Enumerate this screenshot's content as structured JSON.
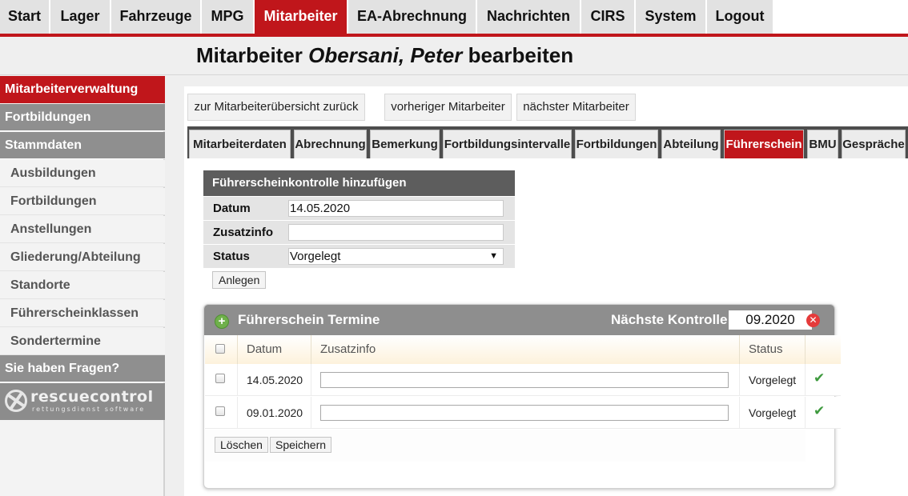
{
  "nav": {
    "items": [
      {
        "label": "Start"
      },
      {
        "label": "Lager"
      },
      {
        "label": "Fahrzeuge"
      },
      {
        "label": "MPG"
      },
      {
        "label": "Mitarbeiter",
        "active": true
      },
      {
        "label": "EA-Abrechnung"
      },
      {
        "label": "Nachrichten"
      },
      {
        "label": "CIRS"
      },
      {
        "label": "System"
      },
      {
        "label": "Logout"
      }
    ],
    "accent_color": "#c0161b"
  },
  "title": {
    "prefix": "Mitarbeiter",
    "name": "Obersani, Peter",
    "suffix": "bearbeiten"
  },
  "sidebar": {
    "items": [
      {
        "label": "Mitarbeiterverwaltung",
        "type": "active"
      },
      {
        "label": "Fortbildungen",
        "type": "section"
      },
      {
        "label": "Stammdaten",
        "type": "section"
      },
      {
        "label": "Ausbildungen",
        "type": "sub"
      },
      {
        "label": "Fortbildungen",
        "type": "sub"
      },
      {
        "label": "Anstellungen",
        "type": "sub"
      },
      {
        "label": "Gliederung/Abteilung",
        "type": "sub"
      },
      {
        "label": "Standorte",
        "type": "sub"
      },
      {
        "label": "Führerscheinklassen",
        "type": "sub"
      },
      {
        "label": "Sondertermine",
        "type": "sub"
      },
      {
        "label": "Sie haben Fragen?",
        "type": "section"
      }
    ],
    "logo": {
      "text": "rescuecontrol",
      "subtext": "rettungsdienst software"
    }
  },
  "buttons": {
    "back": "zur Mitarbeiterübersicht zurück",
    "prev": "vorheriger Mitarbeiter",
    "next": "nächster Mitarbeiter"
  },
  "tabs": [
    {
      "label": "Mitarbeiterdaten"
    },
    {
      "label": "Abrechnung"
    },
    {
      "label": "Bemerkung"
    },
    {
      "label": "Fortbildungsintervalle"
    },
    {
      "label": "Fortbildungen"
    },
    {
      "label": "Abteilung"
    },
    {
      "label": "Führerschein",
      "active": true
    },
    {
      "label": "BMU"
    },
    {
      "label": "Gespräche"
    }
  ],
  "add_form": {
    "header": "Führerscheinkontrolle hinzufügen",
    "datum_label": "Datum",
    "datum_value": "14.05.2020",
    "zusatz_label": "Zusatzinfo",
    "zusatz_value": "",
    "status_label": "Status",
    "status_value": "Vorgelegt",
    "submit": "Anlegen"
  },
  "termine": {
    "title": "Führerschein Termine",
    "next_label": "Nächste Kontrolle",
    "next_value": "09.2020",
    "columns": {
      "datum": "Datum",
      "zusatz": "Zusatzinfo",
      "status": "Status"
    },
    "rows": [
      {
        "datum": "14.05.2020",
        "zusatz": "",
        "status": "Vorgelegt"
      },
      {
        "datum": "09.01.2020",
        "zusatz": "",
        "status": "Vorgelegt"
      }
    ],
    "delete_label": "Löschen",
    "save_label": "Speichern"
  }
}
